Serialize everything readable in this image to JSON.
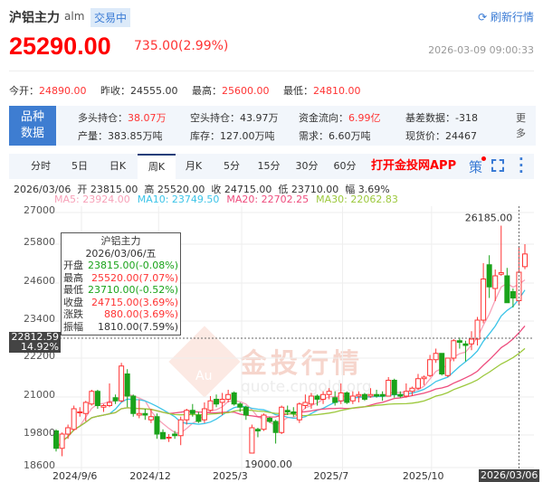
{
  "header": {
    "title": "沪铝主力",
    "code": "alm",
    "status": "交易中",
    "refresh": "刷新行情",
    "price": "25290.00",
    "change": "735.00(2.99%)",
    "time": "2026-03-09 09:00:33"
  },
  "stats": [
    {
      "label": "今开：",
      "value": "24890.00"
    },
    {
      "label": "昨收：",
      "value": "24555.00"
    },
    {
      "label": "最高：",
      "value": "25600.00"
    },
    {
      "label": "最低：",
      "value": "24810.00"
    }
  ],
  "info": {
    "button": "品种数据",
    "items": [
      {
        "label": "多头持仓：",
        "value": "38.07万",
        "red": true
      },
      {
        "label": "空头持仓：",
        "value": "43.97万"
      },
      {
        "label": "资金流向：",
        "value": "6.99亿",
        "red": true
      },
      {
        "label": "基差数据：",
        "value": "-318"
      },
      {
        "label": "产量：",
        "value": "383.85万吨"
      },
      {
        "label": "库存：",
        "value": "127.00万吨"
      },
      {
        "label": "需求：",
        "value": "6.60万吨"
      },
      {
        "label": "现货价：",
        "value": "24467"
      }
    ],
    "more": "更多"
  },
  "tabs": [
    "分时",
    "5日",
    "日K",
    "周K",
    "月K",
    "5分",
    "15分",
    "30分",
    "60分"
  ],
  "active_tab": "周K",
  "app_link": "打开金投网APP",
  "strategy": "策",
  "ohlc_line": "2026/03/06  开 23815.00  高 25520.00  收 24715.00  低 23710.00  幅 3.69%",
  "ma": [
    {
      "label": "MA5: 23924.00",
      "color": "#f7a1b8"
    },
    {
      "label": "MA10: 23749.50",
      "color": "#3cc4e8"
    },
    {
      "label": "MA20: 22702.25",
      "color": "#ee4d7e"
    },
    {
      "label": "MA30: 22062.83",
      "color": "#9cc83c"
    }
  ],
  "tooltip": {
    "title": "沪铝主力",
    "date": "2026/03/06/五",
    "rows": [
      {
        "k": "开盘",
        "v": "23815.00(-0.08%)",
        "c": "g"
      },
      {
        "k": "最高",
        "v": "25520.00(7.07%)",
        "c": "rd"
      },
      {
        "k": "最低",
        "v": "23710.00(-0.52%)",
        "c": "g"
      },
      {
        "k": "收盘",
        "v": "24715.00(3.69%)",
        "c": "rd"
      },
      {
        "k": "涨跌",
        "v": "880.00(3.69%)",
        "c": "rd"
      },
      {
        "k": "振幅",
        "v": "1810.00(7.59%)",
        "c": ""
      }
    ]
  },
  "crosshair": {
    "price": "22812.59",
    "pct": "14.92%",
    "date": "2026/03/06"
  },
  "watermark": {
    "text": "金投行情",
    "url": "quote.cngold.org",
    "logo": "Au"
  },
  "chart_data": {
    "type": "candlestick",
    "ylim": [
      18600,
      27000
    ],
    "yticks": [
      "27000",
      "25800",
      "24600",
      "23400",
      "22200",
      "21000",
      "19800",
      "18600"
    ],
    "xticks": [
      {
        "label": "2024/9/6",
        "i": 0
      },
      {
        "label": "2024/12",
        "i": 13
      },
      {
        "label": "2025/3",
        "i": 27
      },
      {
        "label": "2025/7",
        "i": 44
      },
      {
        "label": "2025/10",
        "i": 59
      }
    ],
    "annotations": [
      {
        "label": "26185.00",
        "i": 75
      },
      {
        "label": "19000.00",
        "i": 33
      }
    ],
    "ohlc": [
      [
        19700,
        19750,
        19050,
        19150
      ],
      [
        19150,
        19650,
        18900,
        19600
      ],
      [
        19600,
        19900,
        19450,
        19800
      ],
      [
        19750,
        20500,
        19700,
        20400
      ],
      [
        20300,
        20450,
        20150,
        20300
      ],
      [
        20250,
        20650,
        20000,
        20600
      ],
      [
        20550,
        21000,
        20500,
        20950
      ],
      [
        20950,
        21000,
        20400,
        20500
      ],
      [
        20450,
        20550,
        20300,
        20500
      ],
      [
        20500,
        21200,
        20450,
        20600
      ],
      [
        20750,
        20850,
        20550,
        20650
      ],
      [
        20650,
        21850,
        20600,
        21750
      ],
      [
        21500,
        21650,
        20450,
        20800
      ],
      [
        20800,
        20850,
        20150,
        20250
      ],
      [
        20200,
        20700,
        20100,
        20250
      ],
      [
        20250,
        20400,
        20050,
        20200
      ],
      [
        20050,
        20400,
        19950,
        20150
      ],
      [
        20150,
        20250,
        19450,
        19600
      ],
      [
        19650,
        19750,
        19450,
        19450
      ],
      [
        19500,
        19600,
        19350,
        19500
      ],
      [
        19600,
        19700,
        19450,
        19550
      ],
      [
        19550,
        20150,
        19250,
        20050
      ],
      [
        20050,
        20400,
        19900,
        20350
      ],
      [
        20350,
        20550,
        20150,
        20250
      ],
      [
        20200,
        20300,
        19950,
        20000
      ],
      [
        20050,
        20600,
        19950,
        20400
      ],
      [
        20350,
        20800,
        20300,
        20650
      ],
      [
        20700,
        20850,
        20450,
        20550
      ],
      [
        20600,
        20900,
        20200,
        20700
      ],
      [
        20700,
        21000,
        20600,
        20850
      ],
      [
        20900,
        20950,
        20500,
        20550
      ],
      [
        20550,
        20600,
        20300,
        20450
      ],
      [
        20450,
        20500,
        20050,
        20200
      ],
      [
        19000,
        19900,
        19000,
        19800
      ],
      [
        19750,
        19800,
        19500,
        19700
      ],
      [
        19750,
        20250,
        19700,
        20200
      ],
      [
        20100,
        20150,
        19950,
        20000
      ],
      [
        20000,
        20050,
        19300,
        19650
      ],
      [
        19650,
        20500,
        19600,
        20450
      ],
      [
        20350,
        20500,
        20200,
        20300
      ],
      [
        20300,
        20450,
        20150,
        20250
      ],
      [
        20050,
        20600,
        19950,
        20550
      ],
      [
        20500,
        20850,
        20400,
        20600
      ],
      [
        20550,
        20900,
        20400,
        20800
      ],
      [
        20800,
        20850,
        20500,
        20700
      ],
      [
        20700,
        20950,
        20550,
        20850
      ],
      [
        20850,
        21050,
        20700,
        20950
      ],
      [
        20750,
        20950,
        20500,
        20600
      ],
      [
        20650,
        21200,
        20550,
        20900
      ],
      [
        20900,
        20950,
        20550,
        20600
      ],
      [
        20650,
        20950,
        20550,
        20800
      ],
      [
        20800,
        20950,
        20600,
        20850
      ],
      [
        20850,
        20900,
        20650,
        20700
      ],
      [
        20800,
        21050,
        20750,
        20850
      ],
      [
        20850,
        21000,
        20750,
        20800
      ],
      [
        20850,
        20950,
        20650,
        20800
      ],
      [
        20800,
        21400,
        20800,
        21300
      ],
      [
        21300,
        21350,
        20750,
        20850
      ],
      [
        20850,
        20950,
        20750,
        20800
      ],
      [
        20800,
        21200,
        20750,
        20950
      ],
      [
        20950,
        21100,
        20800,
        21050
      ],
      [
        21050,
        21500,
        21000,
        21350
      ],
      [
        21350,
        21450,
        21150,
        21400
      ],
      [
        21450,
        22100,
        21400,
        21950
      ],
      [
        21950,
        22300,
        21850,
        22150
      ],
      [
        22150,
        22150,
        21450,
        21500
      ],
      [
        21450,
        22000,
        21400,
        22000
      ],
      [
        22000,
        22600,
        21900,
        22550
      ],
      [
        22550,
        22650,
        22300,
        22500
      ],
      [
        22450,
        22550,
        21900,
        22400
      ],
      [
        22450,
        22850,
        22250,
        22600
      ],
      [
        22600,
        23300,
        22400,
        23200
      ],
      [
        23200,
        25000,
        23100,
        24500
      ],
      [
        24950,
        25250,
        23900,
        24250
      ],
      [
        24200,
        24800,
        23800,
        24600
      ],
      [
        24650,
        26185,
        24600,
        24700
      ],
      [
        24600,
        24850,
        23750,
        23750
      ],
      [
        24100,
        24200,
        23600,
        23900
      ],
      [
        23815,
        25520,
        23710,
        24715
      ],
      [
        24890,
        25600,
        24810,
        25290
      ]
    ],
    "moving_averages": [
      {
        "name": "MA5",
        "period": 5,
        "color": "#f7a1b8"
      },
      {
        "name": "MA10",
        "period": 10,
        "color": "#3cc4e8"
      },
      {
        "name": "MA20",
        "period": 20,
        "color": "#ee4d7e"
      },
      {
        "name": "MA30",
        "period": 30,
        "color": "#9cc83c"
      }
    ],
    "colors": {
      "up": "#f33",
      "down": "#1aa31a"
    }
  }
}
